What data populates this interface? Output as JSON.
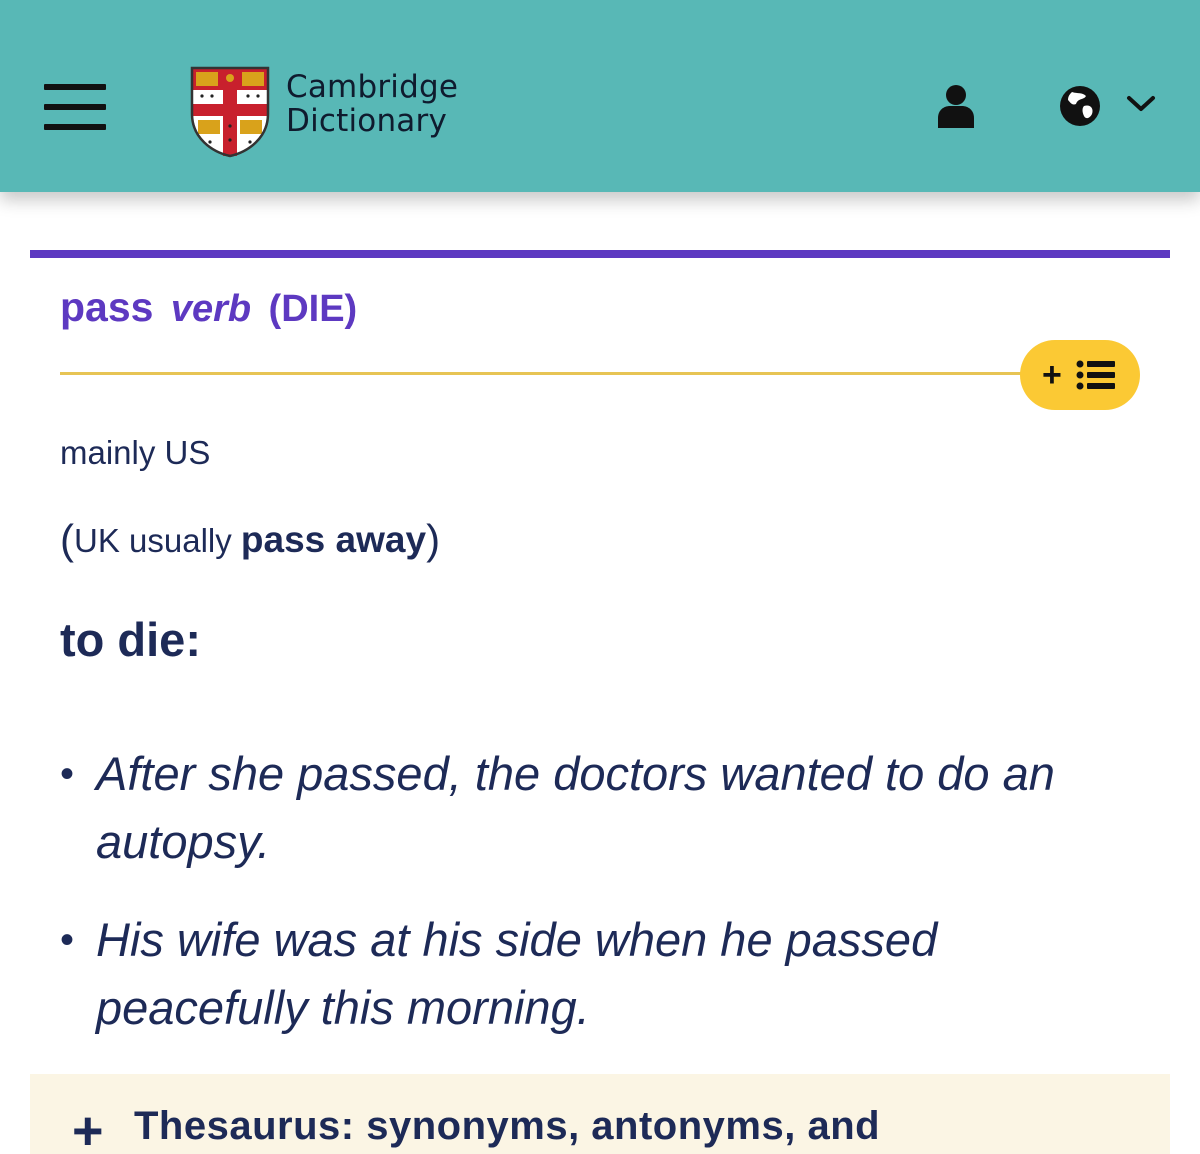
{
  "header": {
    "logo_line1": "Cambridge",
    "logo_line2": "Dictionary",
    "icons": {
      "menu": "hamburger-menu-icon",
      "user": "user-icon",
      "language": "globe-icon",
      "dropdown": "chevron-down-icon",
      "word_list": "list-icon"
    }
  },
  "entry": {
    "headword": "pass",
    "part_of_speech": "verb",
    "guide_word": "(DIE)",
    "word_list_plus": "+",
    "region": "mainly US",
    "variant_open": "(",
    "variant_region": "UK",
    "variant_usage": "usually",
    "variant_term": "pass away",
    "variant_close": ")",
    "definition": "to die:",
    "examples": [
      {
        "bullet": "•",
        "text": "After she passed, the doctors wanted to do an autopsy."
      },
      {
        "bullet": "•",
        "text": "His wife was at his side when he passed peacefully this morning."
      }
    ]
  },
  "thesaurus": {
    "plus": "+",
    "label": "Thesaurus: synonyms, antonyms, and"
  },
  "colors": {
    "header_bg": "#58b8b6",
    "brand_purple": "#5d39c1",
    "accent_yellow": "#fbc934",
    "text_navy": "#1d2a57",
    "thesaurus_bg": "#fbf5e4"
  }
}
